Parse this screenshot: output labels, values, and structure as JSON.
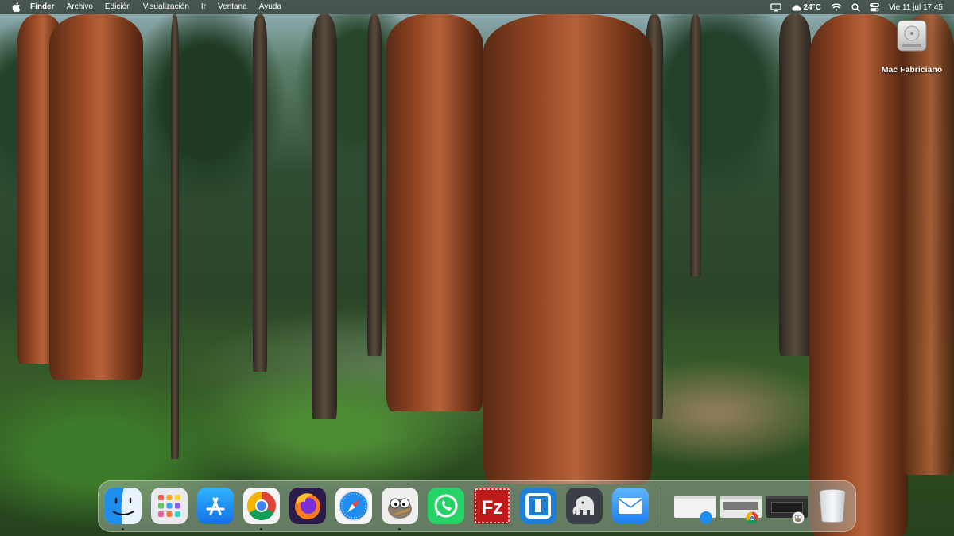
{
  "menubar": {
    "apple_icon": "apple-logo-icon",
    "app_name": "Finder",
    "menus": [
      "Archivo",
      "Edición",
      "Visualización",
      "Ir",
      "Ventana",
      "Ayuda"
    ],
    "status": {
      "weather_temp": "24°C",
      "datetime": "Vie 11 jul 17:45",
      "icons": [
        "screen-mirroring-icon",
        "cloud-icon",
        "wifi-icon",
        "search-icon",
        "control-center-icon"
      ]
    }
  },
  "desktop": {
    "drive_label": "Mac Fabriciano"
  },
  "dock": {
    "apps": [
      {
        "name": "Finder",
        "icon": "finder-icon",
        "running": true
      },
      {
        "name": "Launchpad",
        "icon": "launchpad-icon",
        "running": false
      },
      {
        "name": "App Store",
        "icon": "app-store-icon",
        "running": false
      },
      {
        "name": "Google Chrome",
        "icon": "chrome-icon",
        "running": true
      },
      {
        "name": "Firefox",
        "icon": "firefox-icon",
        "running": false
      },
      {
        "name": "Safari",
        "icon": "safari-icon",
        "running": false
      },
      {
        "name": "GIMP",
        "icon": "gimp-icon",
        "running": true
      },
      {
        "name": "WhatsApp",
        "icon": "whatsapp-icon",
        "running": false
      },
      {
        "name": "FileZilla",
        "icon": "filezilla-icon",
        "running": false
      },
      {
        "name": "Remote Desktop",
        "icon": "remote-desktop-icon",
        "running": false
      },
      {
        "name": "TablePlus",
        "icon": "elephant-icon",
        "running": false
      },
      {
        "name": "Mail",
        "icon": "mail-icon",
        "running": false
      }
    ],
    "minimized": [
      {
        "icon": "minimized-finder-window-icon"
      },
      {
        "icon": "minimized-chrome-window-icon"
      },
      {
        "icon": "minimized-gimp-window-icon"
      }
    ],
    "trash_icon": "trash-icon"
  },
  "colors": {
    "menubar_bg": "#283028",
    "finder_blue": "#1e8df0",
    "whatsapp_green": "#25d366",
    "filezilla_red": "#bf1a1a",
    "mail_blue": "#2f8ff2"
  }
}
